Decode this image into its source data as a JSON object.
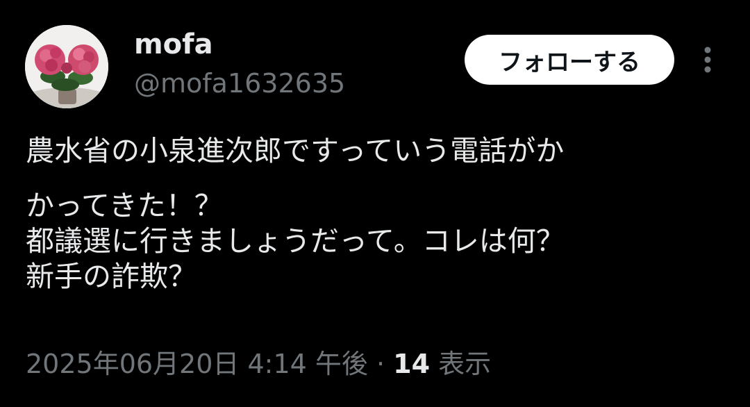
{
  "user": {
    "display_name": "mofa",
    "handle": "@mofa1632635",
    "avatar": "hydrangea-flower-photo"
  },
  "actions": {
    "follow_label": "フォローする",
    "more_icon": "more-vertical-icon"
  },
  "tweet": {
    "lines": [
      "農水省の小泉進次郎ですっていう電話がか",
      "かってきた！？",
      "都議選に行きましょうだって。コレは何？",
      "新手の詐欺？"
    ]
  },
  "meta": {
    "timestamp": "2025年06月20日 4:14 午後",
    "separator": " · ",
    "views_count": "14",
    "views_label": " 表示"
  },
  "colors": {
    "background": "#000000",
    "primary_text": "#e7e9ea",
    "secondary_text": "#71767b",
    "follow_button_bg": "#ffffff",
    "follow_button_text": "#0f1419"
  }
}
